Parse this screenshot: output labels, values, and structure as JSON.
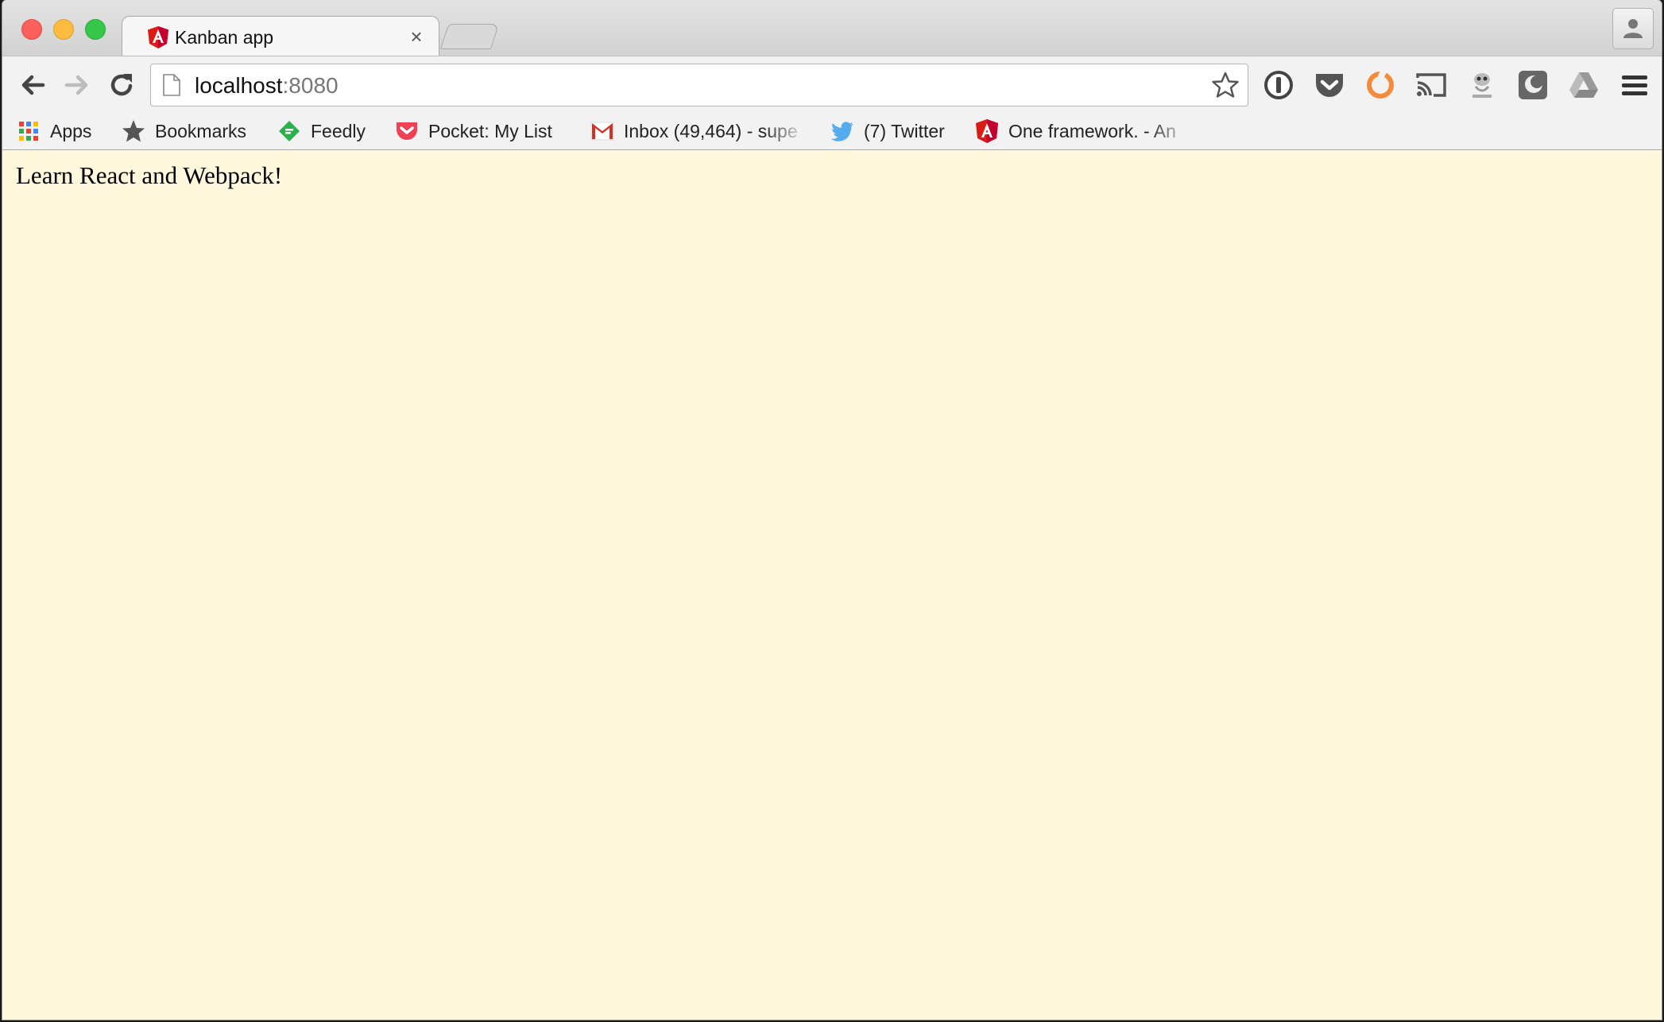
{
  "tab": {
    "title": "Kanban app",
    "close_symbol": "×",
    "favicon": "angular-icon"
  },
  "address_bar": {
    "host": "localhost",
    "port": ":8080"
  },
  "toolbar_icons": [
    "back-arrow-icon",
    "forward-arrow-icon",
    "reload-icon",
    "bookmark-star-icon",
    "onepassword-icon",
    "pocket-icon",
    "ring-icon",
    "cast-icon",
    "grunt-icon",
    "shield-icon",
    "google-drive-icon",
    "menu-icon"
  ],
  "bookmarks": [
    {
      "label": "Apps",
      "icon": "apps-grid-icon"
    },
    {
      "label": "Bookmarks",
      "icon": "star-icon"
    },
    {
      "label": "Feedly",
      "icon": "feedly-icon"
    },
    {
      "label": "Pocket: My List",
      "icon": "pocket-icon"
    },
    {
      "label": "Inbox (49,464) - supe",
      "icon": "gmail-icon"
    },
    {
      "label": "(7) Twitter",
      "icon": "twitter-icon"
    },
    {
      "label": "One framework. - An",
      "icon": "angular-icon"
    }
  ],
  "page": {
    "heading": "Learn React and Webpack!",
    "background_color": "#fff8dc"
  },
  "colors": {
    "close": "#fc605c",
    "minimize": "#fdbc40",
    "maximize": "#34c749",
    "angular_red": "#dd1b16",
    "pocket_red": "#ef4056",
    "feedly_green": "#2bb24c",
    "twitter_blue": "#55acee"
  }
}
